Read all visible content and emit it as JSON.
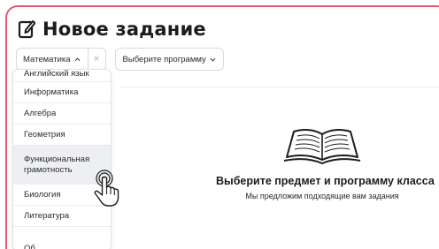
{
  "header": {
    "title": "Новое задание",
    "icon": "edit-document-icon"
  },
  "filters": {
    "subject_value": "Математика",
    "clear_glyph": "×",
    "program_value": "Выберите программу"
  },
  "dropdown": {
    "items": [
      {
        "label": "Английский язык"
      },
      {
        "label": "Информатика"
      },
      {
        "label": "Алгебра"
      },
      {
        "label": "Геометрия"
      },
      {
        "label": "Функциональная грамотность",
        "line1": "Функциональная",
        "line2": "грамотность",
        "hovered": true
      },
      {
        "label": "Биология"
      },
      {
        "label": "Литература"
      },
      {
        "label": "Об"
      }
    ]
  },
  "empty_state": {
    "icon": "open-book-icon",
    "title": "Выберите предмет и программу класса",
    "subtitle": "Мы предложим подходящие вам задания"
  },
  "colors": {
    "frame_border": "#e8576f",
    "hover_bg": "#eeeff2",
    "border": "#d9dadf"
  }
}
